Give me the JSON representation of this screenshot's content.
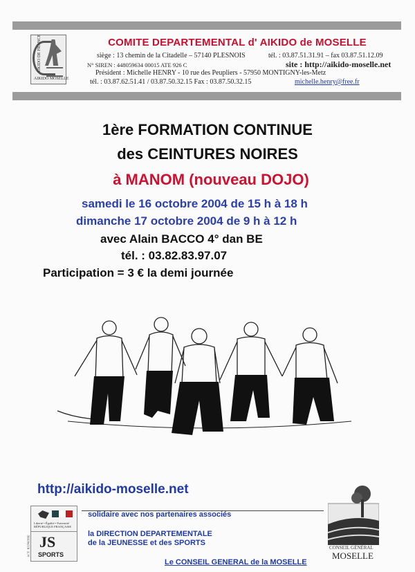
{
  "header": {
    "title": "COMITE DEPARTEMENTAL d' AIKIDO de MOSELLE",
    "line1_siege": "siège : 13 chemin de la Citadelle – 57140 PLESNOIS",
    "line1_tel": "tél. : 03.87.51.31.91 – fax 03.87.51.12.09",
    "line2_siren": "N° SIREN : 448059634 00015   ATE  926 C",
    "line2_site": "site :  http://aikido-moselle.net",
    "line3_president": "Président :  Michelle  HENRY   -  10 rue des Peupliers  -  57950 MONTIGNY-les-Metz",
    "line4_tel": "tél. : 03.87.62.51.41 / 03.87.50.32.15     Fax : 03.87.50.32.15",
    "line4_email": "michelle.henry@free.fr",
    "logo_left_text": "AIKIDO DE FRANCE",
    "logo_left_bottom": "AIKIDO MOSELLE"
  },
  "event": {
    "title_line1": "1ère FORMATION CONTINUE",
    "title_line2": "des CEINTURES NOIRES",
    "location": "à MANOM  (nouveau DOJO)",
    "date1": "samedi le 16 octobre 2004  de 15 h à 18 h",
    "date2": "dimanche 17 octobre 2004  de   9 h à 12 h",
    "instructor": "avec  Alain BACCO   4° dan   BE",
    "phone": "tél. : 03.82.83.97.07",
    "participation": "Participation =  3 € la demi journée"
  },
  "footer": {
    "url": "http://aikido-moselle.net",
    "partners_intro": "solidaire avec  nos partenaires associés",
    "ddjs_line1": "la DIRECTION DEPARTEMENTALE",
    "ddjs_line2": "de la JEUNESSE et des SPORTS",
    "conseil": "Le CONSEIL GENERAL de la MOSELLE",
    "logo1_text": "Liberté • Égalité • Fraternité RÉPUBLIQUE FRANÇAISE",
    "logo2_text": "SPORTS",
    "logo2_vertical": "ACT. JEUNESSE",
    "cg_line1": "CONSEIL GÉNÉRAL",
    "cg_line2": "MOSELLE"
  },
  "colors": {
    "title_red": "#c8102e",
    "accent_blue": "#1f3aa8",
    "bar_gray": "#9b9b9b"
  }
}
